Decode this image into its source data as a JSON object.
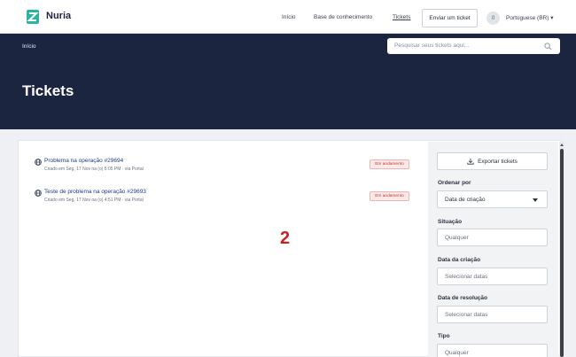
{
  "navbar": {
    "brand": "Nuria",
    "links": [
      "Início",
      "Base de conhecimento",
      "Tickets"
    ],
    "submit_button": "Enviar um ticket",
    "avatar_initial": "0",
    "language": "Portuguese (BR) ▾"
  },
  "hero": {
    "breadcrumb": "Início",
    "search_placeholder": "Pesquisar seus tickets aqui...",
    "title": "Tickets"
  },
  "tickets": [
    {
      "title": "Problema na operação #29694",
      "meta": "Criado em Seg, 17 Nov na (o) 5:05 PM · via Portal",
      "status": "Em andamento"
    },
    {
      "title": "Teste de problema na operação #29693",
      "meta": "Criado em Seg, 17 Nov na (o) 4:51 PM · via Portal",
      "status": "Em andamento"
    }
  ],
  "overlay_number": "2",
  "filters": {
    "export_label": "Exportar tickets",
    "sort_label": "Ordenar por",
    "sort_value": "Data de criação",
    "status_label": "Situação",
    "status_value": "Qualquer",
    "created_label": "Data da criação",
    "created_value": "Selecionar datas",
    "resolved_label": "Data de resolução",
    "resolved_value": "Selecionar datas",
    "type_label": "Tipo",
    "type_value": "Qualquer"
  },
  "colors": {
    "navy": "#1b2540",
    "link": "#1e3a8a",
    "badge_red": "#c0392b",
    "overlay_red": "#cc1f1f"
  }
}
